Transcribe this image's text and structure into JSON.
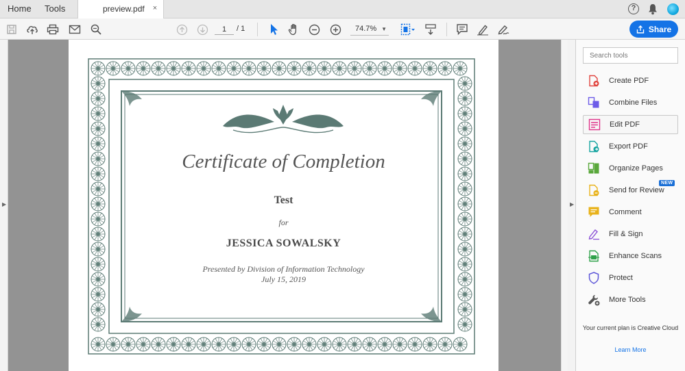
{
  "tabs": {
    "home": "Home",
    "tools": "Tools",
    "document": "preview.pdf",
    "close_glyph": "×"
  },
  "header": {
    "help_glyph": "?",
    "icons": [
      "help-icon",
      "bell-icon",
      "avatar"
    ]
  },
  "toolbar": {
    "current_page": "1",
    "total_pages": "/ 1",
    "zoom": "74.7%",
    "share_label": "Share"
  },
  "certificate": {
    "title": "Certificate of Completion",
    "course": "Test",
    "for": "for",
    "recipient": "JESSICA SOWALSKY",
    "presented_by": "Presented by Division of Information Technology",
    "date": "July 15, 2019",
    "border_color": "#5b7a74"
  },
  "tools_pane": {
    "search_placeholder": "Search tools",
    "items": [
      {
        "label": "Create PDF",
        "icon": "create-pdf-icon",
        "color": "#e0443e"
      },
      {
        "label": "Combine Files",
        "icon": "combine-files-icon",
        "color": "#6d5ce8"
      },
      {
        "label": "Edit PDF",
        "icon": "edit-pdf-icon",
        "color": "#e0338a"
      },
      {
        "label": "Export PDF",
        "icon": "export-pdf-icon",
        "color": "#13a39f"
      },
      {
        "label": "Organize Pages",
        "icon": "organize-pages-icon",
        "color": "#5aa83c"
      },
      {
        "label": "Send for Review",
        "icon": "send-for-review-icon",
        "color": "#e8b21a"
      },
      {
        "label": "Comment",
        "icon": "comment-icon",
        "color": "#e8b21a"
      },
      {
        "label": "Fill & Sign",
        "icon": "fill-sign-icon",
        "color": "#8a4fd6"
      },
      {
        "label": "Enhance Scans",
        "icon": "enhance-scans-icon",
        "color": "#2fa14a"
      },
      {
        "label": "Protect",
        "icon": "protect-icon",
        "color": "#5d56d8"
      },
      {
        "label": "More Tools",
        "icon": "more-tools-icon",
        "color": "#555555"
      }
    ],
    "new_badge": "NEW",
    "plan_text": "Your current plan is Creative Cloud",
    "learn_more": "Learn More"
  },
  "colors": {
    "accent": "#1473e6",
    "doc_background": "#939393"
  }
}
